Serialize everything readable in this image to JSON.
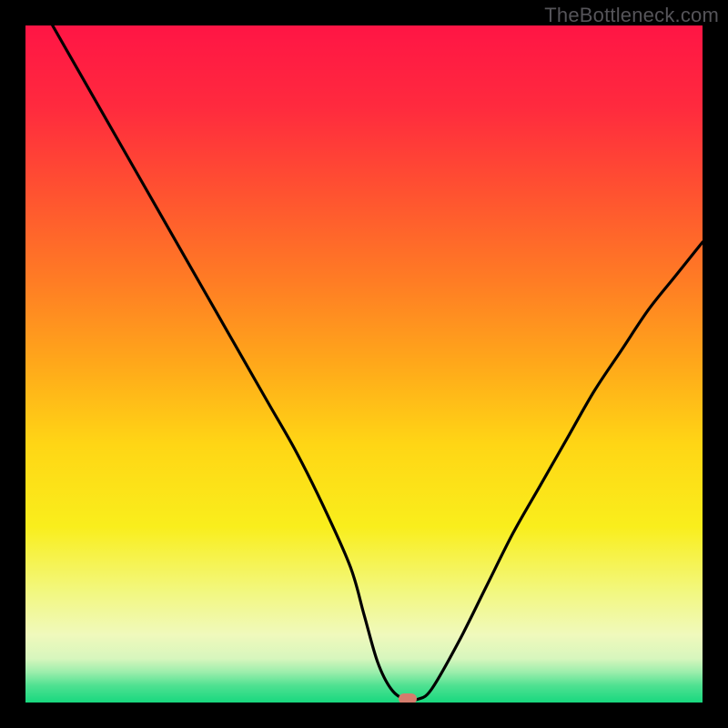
{
  "watermark": "TheBottleneck.com",
  "chart_data": {
    "type": "line",
    "title": "",
    "xlabel": "",
    "ylabel": "",
    "xlim": [
      0,
      100
    ],
    "ylim": [
      0,
      100
    ],
    "grid": false,
    "legend": false,
    "series": [
      {
        "name": "bottleneck-curve",
        "x": [
          4,
          8,
          12,
          16,
          20,
          24,
          28,
          32,
          36,
          40,
          44,
          48,
          50,
          52,
          54,
          56,
          58,
          60,
          64,
          68,
          72,
          76,
          80,
          84,
          88,
          92,
          96,
          100
        ],
        "values": [
          100,
          93,
          86,
          79,
          72,
          65,
          58,
          51,
          44,
          37,
          29,
          20,
          13,
          6,
          2,
          0.5,
          0.5,
          2,
          9,
          17,
          25,
          32,
          39,
          46,
          52,
          58,
          63,
          68
        ]
      }
    ],
    "marker": {
      "x": 56.5,
      "y": 0.5,
      "color": "#d57d6d"
    },
    "gradient_stops": [
      {
        "pos": 0.0,
        "color": "#ff1545"
      },
      {
        "pos": 0.12,
        "color": "#ff2a3e"
      },
      {
        "pos": 0.25,
        "color": "#ff5330"
      },
      {
        "pos": 0.38,
        "color": "#ff7d24"
      },
      {
        "pos": 0.5,
        "color": "#ffa81a"
      },
      {
        "pos": 0.62,
        "color": "#ffd615"
      },
      {
        "pos": 0.74,
        "color": "#f9ee1c"
      },
      {
        "pos": 0.84,
        "color": "#f2f883"
      },
      {
        "pos": 0.9,
        "color": "#f0f9bc"
      },
      {
        "pos": 0.935,
        "color": "#d7f6bd"
      },
      {
        "pos": 0.955,
        "color": "#9ceeac"
      },
      {
        "pos": 0.975,
        "color": "#4fe191"
      },
      {
        "pos": 1.0,
        "color": "#18d87f"
      }
    ]
  }
}
